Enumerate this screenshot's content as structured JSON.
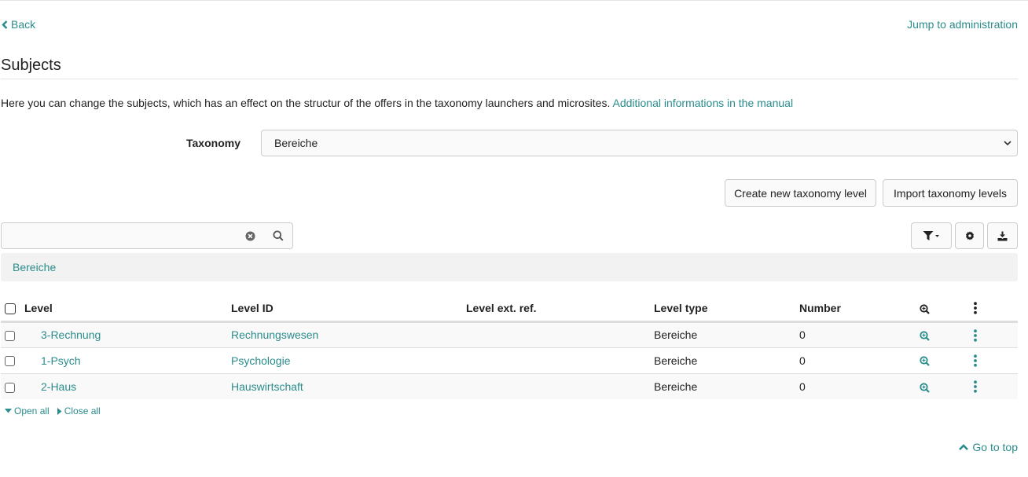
{
  "nav": {
    "back_label": "Back",
    "admin_label": "Jump to administration"
  },
  "page": {
    "title": "Subjects",
    "description": "Here you can change the subjects, which has an effect on the structur of the offers in the taxonomy launchers and microsites.",
    "manual_link": "Additional informations in the manual"
  },
  "taxonomy": {
    "label": "Taxonomy",
    "selected": "Bereiche"
  },
  "actions": {
    "create_label": "Create new taxonomy level",
    "import_label": "Import taxonomy levels"
  },
  "search": {
    "value": "",
    "placeholder": ""
  },
  "breadcrumb": {
    "label": "Bereiche"
  },
  "table": {
    "headers": {
      "level": "Level",
      "level_id": "Level ID",
      "ext_ref": "Level ext. ref.",
      "type": "Level type",
      "number": "Number"
    },
    "rows": [
      {
        "level": "3-Rechnung",
        "level_id": "Rechnungswesen",
        "ext_ref": "",
        "type": "Bereiche",
        "number": "0"
      },
      {
        "level": "1-Psych",
        "level_id": "Psychologie",
        "ext_ref": "",
        "type": "Bereiche",
        "number": "0"
      },
      {
        "level": "2-Haus",
        "level_id": "Hauswirtschaft",
        "ext_ref": "",
        "type": "Bereiche",
        "number": "0"
      }
    ]
  },
  "tree": {
    "open_all": "Open all",
    "close_all": "Close all"
  },
  "footer": {
    "top_label": "Go to top"
  },
  "colors": {
    "link": "#2a8c8c",
    "text": "#222222"
  }
}
